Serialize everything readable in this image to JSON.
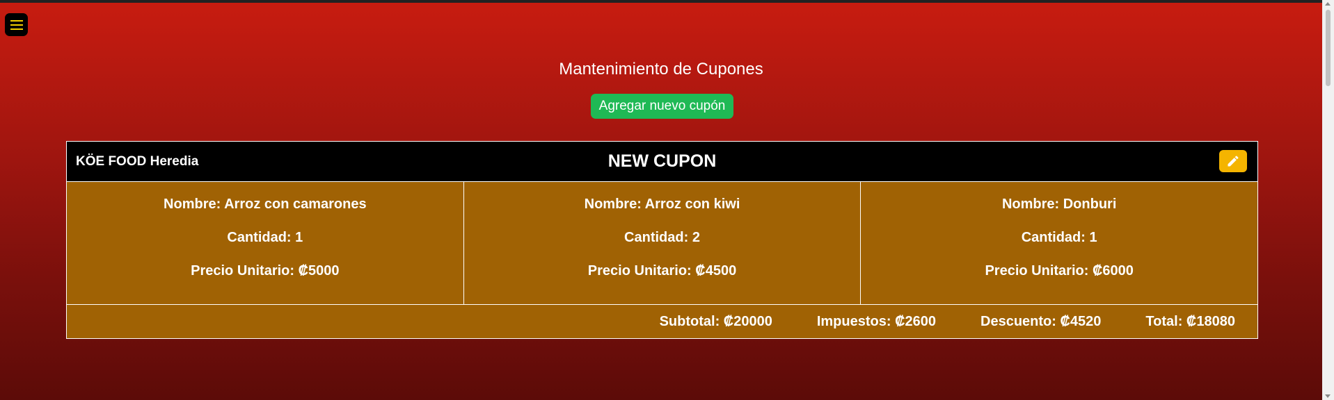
{
  "page": {
    "title": "Mantenimiento de Cupones",
    "add_button_label": "Agregar nuevo cupón"
  },
  "coupon": {
    "store": "KÖE FOOD Heredia",
    "name": "NEW CUPON",
    "items": [
      {
        "name": "Nombre: Arroz con camarones",
        "quantity": "Cantidad: 1",
        "price": "Precio Unitario: ₡5000"
      },
      {
        "name": "Nombre: Arroz con kiwi",
        "quantity": "Cantidad: 2",
        "price": "Precio Unitario: ₡4500"
      },
      {
        "name": "Nombre: Donburi",
        "quantity": "Cantidad: 1",
        "price": "Precio Unitario: ₡6000"
      }
    ],
    "totals": {
      "subtotal": "Subtotal: ₡20000",
      "taxes": "Impuestos: ₡2600",
      "discount": "Descuento: ₡4520",
      "total": "Total: ₡18080"
    }
  },
  "icons": {
    "menu": "hamburger-menu-icon",
    "edit": "pencil-icon"
  },
  "colors": {
    "accent_green": "#1fb955",
    "edit_yellow": "#f4b400",
    "card_brown": "#a06204",
    "header_black": "#000000"
  }
}
